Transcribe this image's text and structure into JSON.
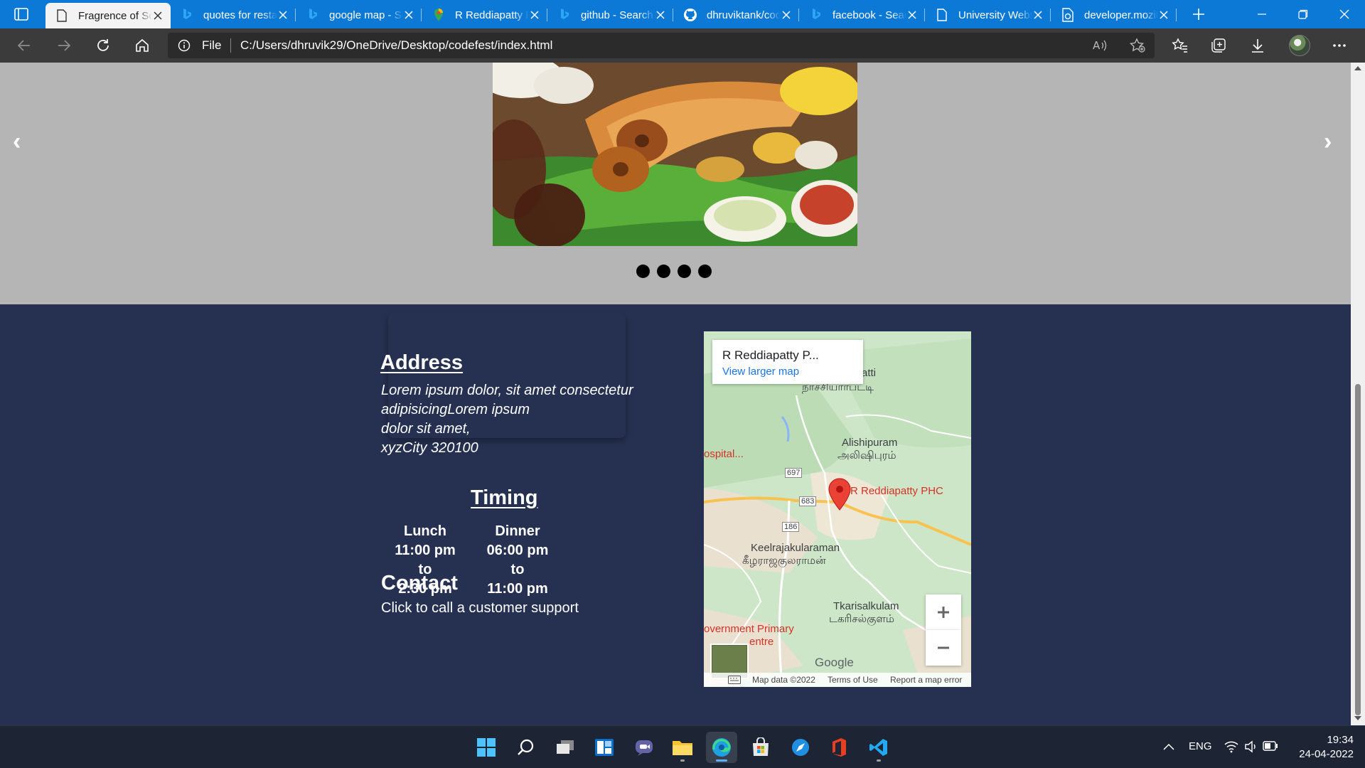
{
  "browser": {
    "tabs": [
      {
        "title": "Fragrence of South",
        "icon": "page-icon",
        "active": true
      },
      {
        "title": "quotes for restaurant",
        "icon": "bing-icon",
        "active": false
      },
      {
        "title": "google map - Search",
        "icon": "bing-icon",
        "active": false
      },
      {
        "title": "R Reddiapatty PHC",
        "icon": "google-maps-icon",
        "active": false
      },
      {
        "title": "github - Search",
        "icon": "bing-icon",
        "active": false
      },
      {
        "title": "dhruviktank/codefest",
        "icon": "github-icon",
        "active": false
      },
      {
        "title": "facebook - Search",
        "icon": "bing-icon",
        "active": false
      },
      {
        "title": "University Website",
        "icon": "page-icon",
        "active": false
      },
      {
        "title": "developer.mozilla.org",
        "icon": "mdn-icon",
        "active": false
      }
    ],
    "address": {
      "scheme_label": "File",
      "url": "C:/Users/dhruvik29/OneDrive/Desktop/codefest/index.html"
    }
  },
  "page": {
    "slider": {
      "prev_label": "‹",
      "next_label": "›",
      "dot_count": 4
    },
    "address": {
      "heading": "Address",
      "lines": [
        "Lorem ipsum dolor, sit amet consectetur",
        "adipisicingLorem ipsum",
        "dolor sit amet,",
        "xyzCity 320100"
      ]
    },
    "timing": {
      "heading": "Timing",
      "lunch": {
        "label": "Lunch",
        "from": "11:00 pm",
        "to_word": "to",
        "to": "2:30 pm"
      },
      "dinner": {
        "label": "Dinner",
        "from": "06:00 pm",
        "to_word": "to",
        "to": "11:00 pm"
      }
    },
    "contact": {
      "heading": "Contact",
      "text": "Click to call a customer support"
    },
    "map": {
      "place_title": "R Reddiapatty P...",
      "larger_map_link": "View larger map",
      "labels": {
        "top_tamil": "நாச்சியார்பட்டி",
        "top_partial": "atti",
        "hospital": "ospital...",
        "alishipuram": "Alishipuram",
        "alishipuram_tamil": "அலிஷிபுரம்",
        "pin_label": "R Reddiapatty PHC",
        "road_697": "697",
        "road_683": "683",
        "road_186": "186",
        "keel": "Keelrajakularaman",
        "keel_tamil": "கீழராஜகுலராமன்",
        "tkari": "Tkarisalkulam",
        "tkari_tamil": "டகரிசல்குளம்",
        "gov1": "overnment Primary",
        "gov2": "entre",
        "google": "Google"
      },
      "zoom_in": "+",
      "zoom_out": "−",
      "attribution": {
        "map_data": "Map data ©2022",
        "terms": "Terms of Use",
        "report": "Report a map error"
      }
    }
  },
  "taskbar": {
    "apps": [
      "windows-start-icon",
      "search-icon",
      "task-view-icon",
      "widgets-icon",
      "teams-chat-icon",
      "file-explorer-icon",
      "edge-icon",
      "microsoft-store-icon",
      "safari-like-icon",
      "office-icon",
      "vscode-icon"
    ],
    "language": "ENG",
    "time": "19:34",
    "date": "24-04-2022"
  },
  "colors": {
    "titlebar": "#0c79d6",
    "toolbar": "#3b3b3b",
    "slider_band": "#b5b5b5",
    "footer": "#263152",
    "map_pin": "#ea4335",
    "link": "#1a73e8"
  }
}
